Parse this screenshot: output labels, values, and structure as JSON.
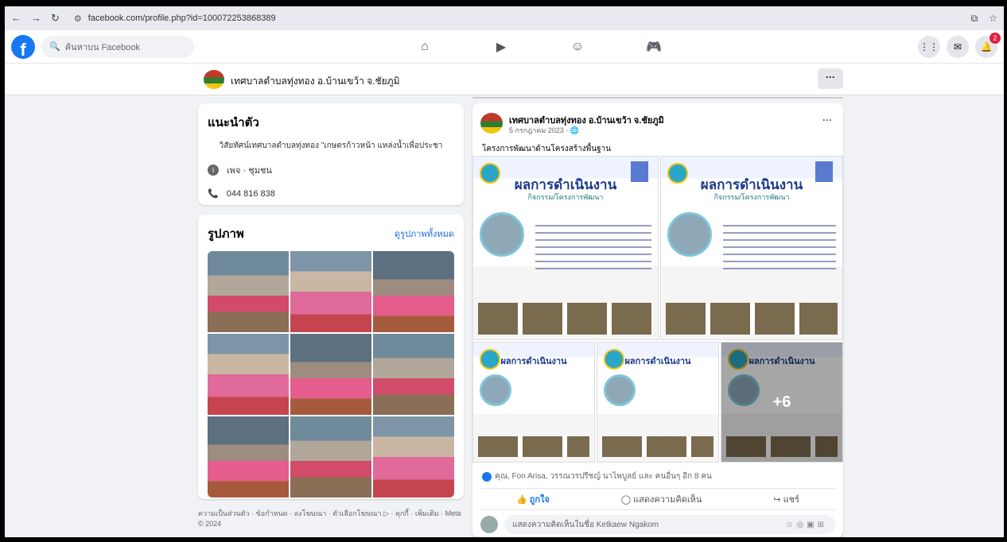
{
  "browser": {
    "url": "facebook.com/profile.php?id=100072253868389"
  },
  "fb": {
    "logo": "f",
    "search_placeholder": "ค้นหาบน Facebook",
    "notification_count": "2"
  },
  "page": {
    "name": "เทศบาลตำบลทุ่งทอง อ.บ้านเขว้า จ.ชัยภูมิ",
    "more": "···"
  },
  "intro": {
    "title": "แนะนำตัว",
    "bio": "วิสัยทัศน์เทศบาลตำบลทุ่งทอง \"เกษตรก้าวหน้า แหล่งน้ำเพื่อประชา",
    "category": "เพจ · ชุมชน",
    "phone": "044 816 838"
  },
  "photos": {
    "title": "รูปภาพ",
    "see_all": "ดูรูปภาพทั้งหมด"
  },
  "footer": "ความเป็นส่วนตัว · ข้อกำหนด · ลงโฆษณา · ตัวเลือกโฆษณา ▷ · คุกกี้ · เพิ่มเติม · Meta © 2024",
  "post": {
    "author": "เทศบาลตำบลทุ่งทอง อ.บ้านเขว้า จ.ชัยภูมิ",
    "date": "5 กรกฎาคม 2023 · 🌐",
    "more": "···",
    "text": "โครงการพัฒนาด้านโครงสร้างพื้นฐาน",
    "tile_title": "ผลการดำเนินงาน",
    "tile_subtitle": "กิจกรรม/โครงการพัฒนา",
    "more_count": "+6",
    "reactions": "คุณ, Fon Arisa, วรรณวรปรีชญ์ นาไพบูลย์ และ คนอื่นๆ อีก 8 คน",
    "like": "ถูกใจ",
    "comment": "แสดงความคิดเห็น",
    "share": "แชร์",
    "comment_placeholder": "แสดงความคิดเห็นในชื่อ Ketkaew Ngakom"
  }
}
